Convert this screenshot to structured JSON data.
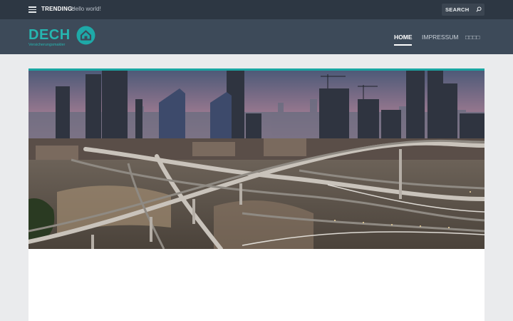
{
  "topbar": {
    "trending_label": "TRENDING:",
    "trending_link": "Hello world!",
    "search_label": "SEARCH",
    "menu_icon": "hamburger-menu-icon",
    "search_icon": "search-icon"
  },
  "header": {
    "logo_text": "DECH",
    "logo_tagline": "Versicherungsmakler",
    "logo_icon": "house-circle-icon",
    "nav": [
      {
        "label": "HOME",
        "active": true
      },
      {
        "label": "IMPRESSUM",
        "active": false
      },
      {
        "label": "□□□□",
        "active": false
      }
    ]
  },
  "main": {
    "hero_image": "city-skyline-highway-interchange-photo"
  },
  "colors": {
    "topbar_bg": "#2d3743",
    "header_bg": "#3d4a59",
    "accent": "#1aa5a2",
    "page_bg": "#eaebed"
  }
}
